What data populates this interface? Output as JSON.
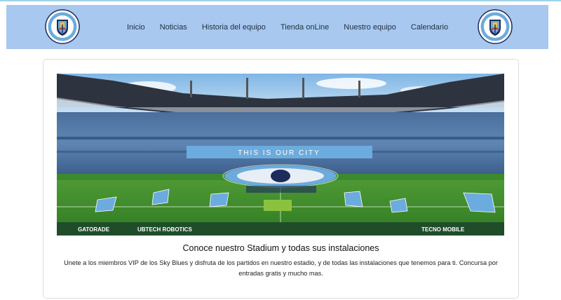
{
  "nav": {
    "logo_left_icon": "manchester-city-crest-icon",
    "logo_right_icon": "manchester-city-crest-icon",
    "items": [
      {
        "label": "Inicio"
      },
      {
        "label": "Noticias"
      },
      {
        "label": "Historia del equipo"
      },
      {
        "label": "Tienda onLine"
      },
      {
        "label": "Nuestro equipo"
      },
      {
        "label": "Calendario"
      }
    ]
  },
  "card": {
    "image_alt": "stadium-photo",
    "banner_text": "THIS IS OUR CITY",
    "ad_boards": [
      "GATORADE",
      "UBTECH ROBOTICS",
      "TECNO MOBILE"
    ],
    "title": "Conoce nuestro Stadium y todas sus instalaciones",
    "text": "Unete a los miembros VIP de los Sky Blues y disfruta de los partidos en nuestro estadio, y de todas las instalaciones que tenemos para ti. Concursa por entradas gratis y mucho mas."
  },
  "colors": {
    "navbar_bg": "#a8c8ef",
    "sky_blue": "#6cabdd",
    "pitch_green": "#3f8c2e"
  }
}
